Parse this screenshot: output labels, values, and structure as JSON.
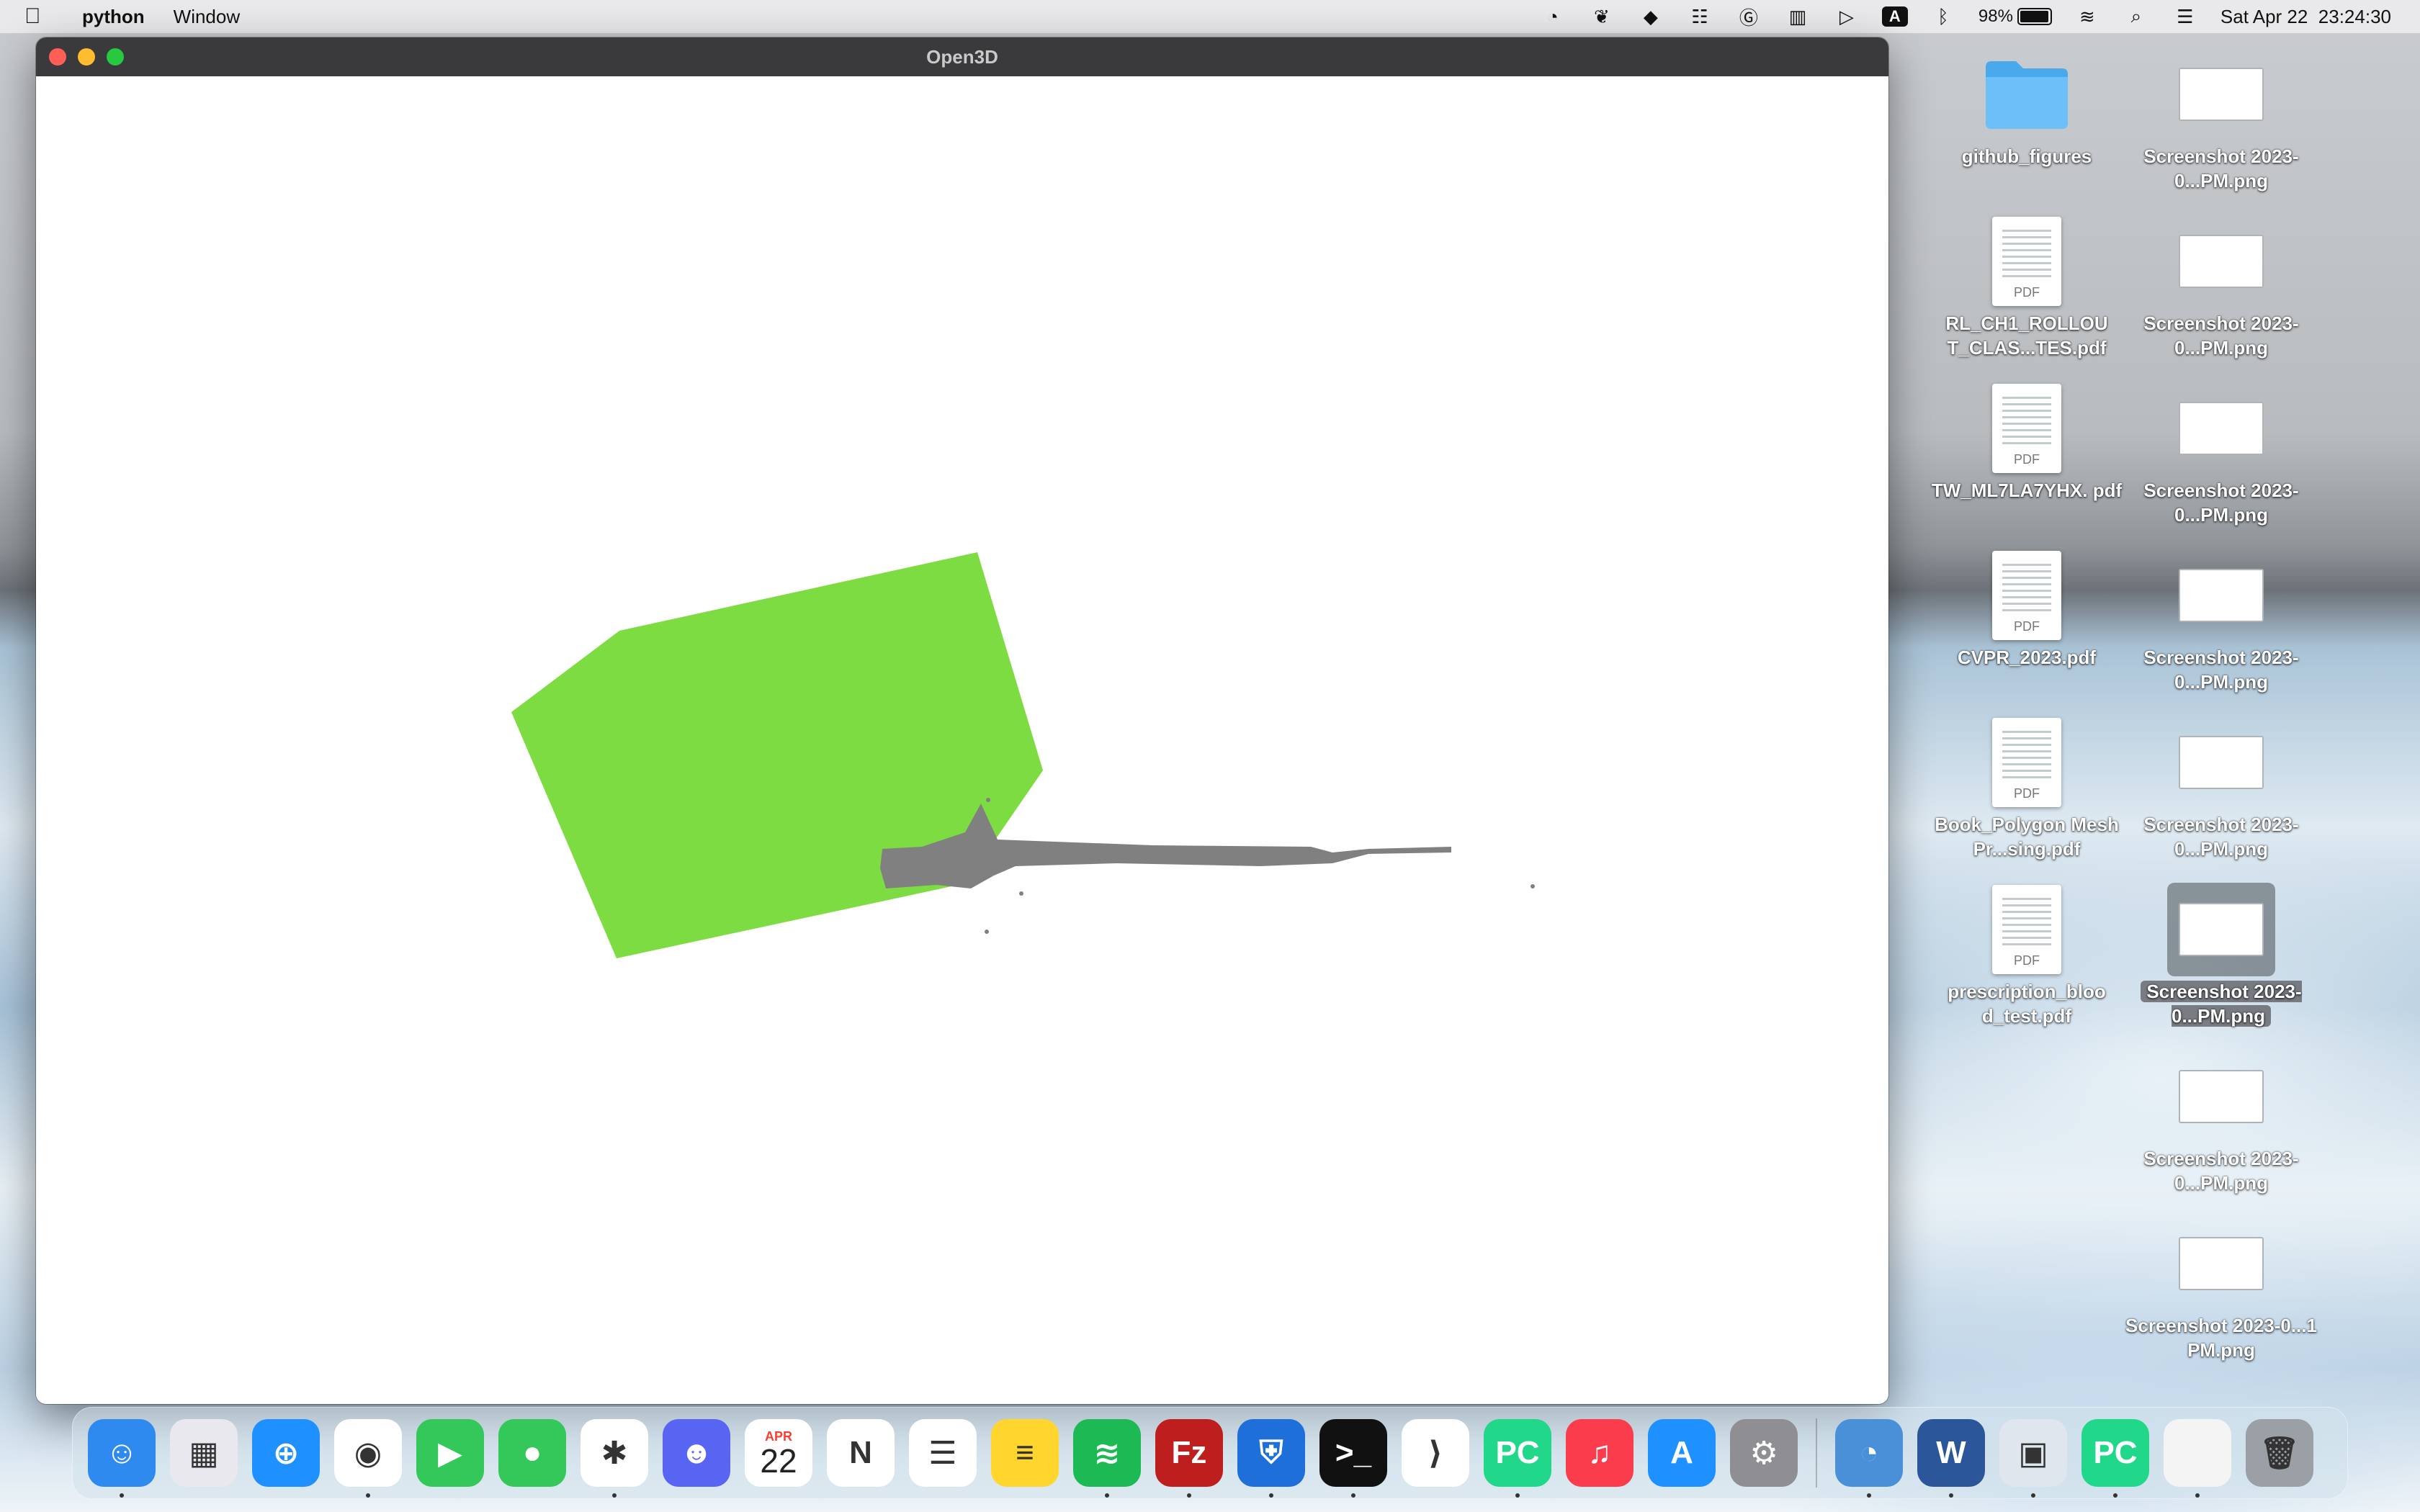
{
  "menubar": {
    "app_name": "python",
    "menus": [
      "Window"
    ],
    "battery_percent": "98%",
    "battery_level": 0.98,
    "datetime": "Sat Apr 22  23:24:30",
    "keyboard_input": "A"
  },
  "window": {
    "title": "Open3D"
  },
  "scene": {
    "background": "#ffffff",
    "polygon_color": "#7ddc41",
    "pointcloud_color": "#808080"
  },
  "desktop": {
    "items": [
      {
        "label": "github_figures",
        "kind": "folder"
      },
      {
        "label": "Screenshot 2023-0...PM.png",
        "kind": "image"
      },
      {
        "label": "RL_CH1_ROLLOU T_CLAS...TES.pdf",
        "kind": "pdf"
      },
      {
        "label": "Screenshot 2023-0...PM.png",
        "kind": "image"
      },
      {
        "label": "TW_ML7LA7YHX. pdf",
        "kind": "pdf"
      },
      {
        "label": "Screenshot 2023-0...PM.png",
        "kind": "image"
      },
      {
        "label": "CVPR_2023.pdf",
        "kind": "pdf"
      },
      {
        "label": "Screenshot 2023-0...PM.png",
        "kind": "image"
      },
      {
        "label": "Book_Polygon Mesh Pr...sing.pdf",
        "kind": "pdf"
      },
      {
        "label": "Screenshot 2023-0...PM.png",
        "kind": "image"
      },
      {
        "label": "prescription_bloo d_test.pdf",
        "kind": "pdf"
      },
      {
        "label": "Screenshot 2023-0...PM.png",
        "kind": "image",
        "selected": true
      },
      {
        "label": "Screenshot 2023-0...PM.png",
        "kind": "image"
      },
      {
        "label": "Screenshot 2023-0...1 PM.png",
        "kind": "image"
      }
    ]
  },
  "dock": {
    "calendar_month": "APR",
    "calendar_day": "22",
    "apps": [
      {
        "name": "finder-icon",
        "color": "#2f8af0",
        "glyph": "☺"
      },
      {
        "name": "launchpad-icon",
        "color": "#e8e8ee",
        "glyph": "▦"
      },
      {
        "name": "safari-icon",
        "color": "#1e90ff",
        "glyph": "⊕"
      },
      {
        "name": "chrome-icon",
        "color": "#ffffff",
        "glyph": "◉"
      },
      {
        "name": "facetime-icon",
        "color": "#34c759",
        "glyph": "▶"
      },
      {
        "name": "messages-icon",
        "color": "#34c759",
        "glyph": "●"
      },
      {
        "name": "slack-icon",
        "color": "#ffffff",
        "glyph": "✱"
      },
      {
        "name": "discord-icon",
        "color": "#5865f2",
        "glyph": "☻"
      },
      {
        "name": "calendar-icon",
        "color": "#ffffff",
        "glyph": ""
      },
      {
        "name": "notion-icon",
        "color": "#ffffff",
        "glyph": "N"
      },
      {
        "name": "reminders-icon",
        "color": "#ffffff",
        "glyph": "☰"
      },
      {
        "name": "notes-icon",
        "color": "#ffd52e",
        "glyph": "≡"
      },
      {
        "name": "spotify-icon",
        "color": "#1db954",
        "glyph": "≋"
      },
      {
        "name": "filezilla-icon",
        "color": "#bf1e1e",
        "glyph": "Fz"
      },
      {
        "name": "vpn-shield-icon",
        "color": "#1e6fd9",
        "glyph": "⛨"
      },
      {
        "name": "terminal-icon",
        "color": "#111111",
        "glyph": ">_"
      },
      {
        "name": "vscode-icon",
        "color": "#ffffff",
        "glyph": "⟩"
      },
      {
        "name": "pycharm-icon",
        "color": "#21d789",
        "glyph": "PC"
      },
      {
        "name": "music-icon",
        "color": "#fa3c4c",
        "glyph": "♫"
      },
      {
        "name": "app-store-icon",
        "color": "#1e90ff",
        "glyph": "A"
      },
      {
        "name": "system-settings-icon",
        "color": "#8e8e93",
        "glyph": "⚙"
      }
    ],
    "recent": [
      {
        "name": "time-tracker-icon",
        "color": "#4a90d9",
        "glyph": "◔"
      },
      {
        "name": "word-icon",
        "color": "#2b579a",
        "glyph": "W"
      },
      {
        "name": "preview-icon",
        "color": "#dfe6ee",
        "glyph": "▣"
      },
      {
        "name": "pycharm-icon",
        "color": "#21d789",
        "glyph": "PC"
      },
      {
        "name": "document-icon",
        "color": "#f4f4f4",
        "glyph": ""
      }
    ],
    "trash": {
      "name": "trash-icon",
      "color": "#9aa0a6",
      "glyph": "🗑"
    }
  }
}
